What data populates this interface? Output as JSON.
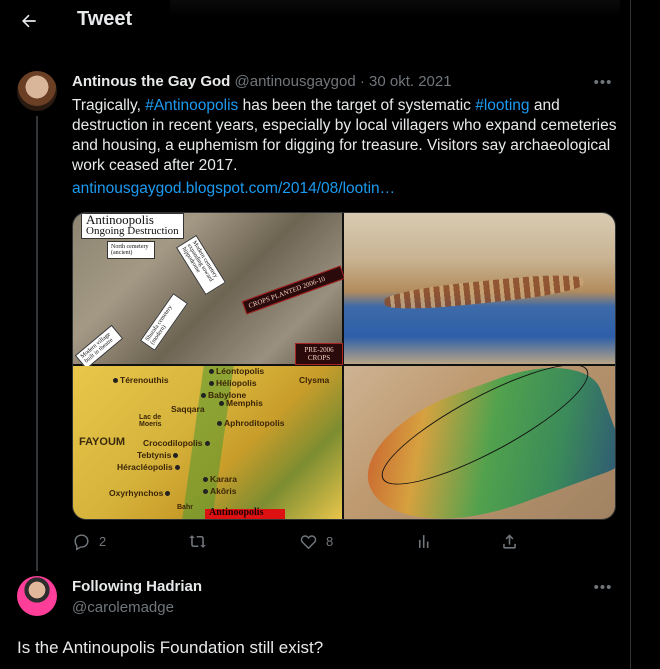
{
  "header": {
    "title": "Tweet"
  },
  "tweet": {
    "author_name": "Antinous the Gay God",
    "handle": "@antinousgaygod",
    "separator": "·",
    "date": "30 okt. 2021",
    "text_parts": [
      "Tragically, ",
      "#Antinoopolis",
      " has been the target of systematic ",
      "#looting",
      " and destruction in recent years, especially by local villagers who expand cemeteries and housing, a euphemism for digging for treasure. Visitors say archaeological work ceased after 2017."
    ],
    "link": "antinousgaygod.blogspot.com/2014/08/lootin…",
    "media": {
      "satellite": {
        "title1": "Antinoopolis",
        "title2": "Ongoing Destruction",
        "box_north_cemetery": "North cemetery (ancient)",
        "box_modern_cemetery": "Modern cemetery expanding toward hippodrome",
        "box_shurafa": "Shurafa cemetery (modern)",
        "box_village": "Modern village built in theatre",
        "red_crops": "CROPS PLANTED 2006-10",
        "red_pre": "PRE-2006 CROPS"
      },
      "map": {
        "labels": [
          "Térenouthis",
          "Léontopolis",
          "Héliopolis",
          "Babylone",
          "Clysma",
          "Saqqara",
          "Memphis",
          "Aphroditopolis",
          "Lac de Moeris",
          "FAYOUM",
          "Crocodilopolis",
          "Tebtynis",
          "Héracléopolis",
          "Oxyrhynchos",
          "Karara",
          "Akôris",
          "Bahr"
        ],
        "highlight": "Antinoopolis"
      }
    },
    "stats": {
      "replies": "2",
      "retweets": "",
      "likes": "8"
    }
  },
  "reply": {
    "author_name": "Following Hadrian",
    "handle": "@carolemadge",
    "text": "Is the Antinoupolis Foundation still exist?"
  },
  "icons": [
    "back-arrow-icon",
    "more-icon",
    "reply-icon",
    "retweet-icon",
    "like-icon",
    "analytics-icon",
    "share-icon"
  ],
  "colors": {
    "background": "#000000",
    "text": "#e7e9ea",
    "muted": "#71767b",
    "accent": "#1d9bf0",
    "border": "#2f3336"
  }
}
